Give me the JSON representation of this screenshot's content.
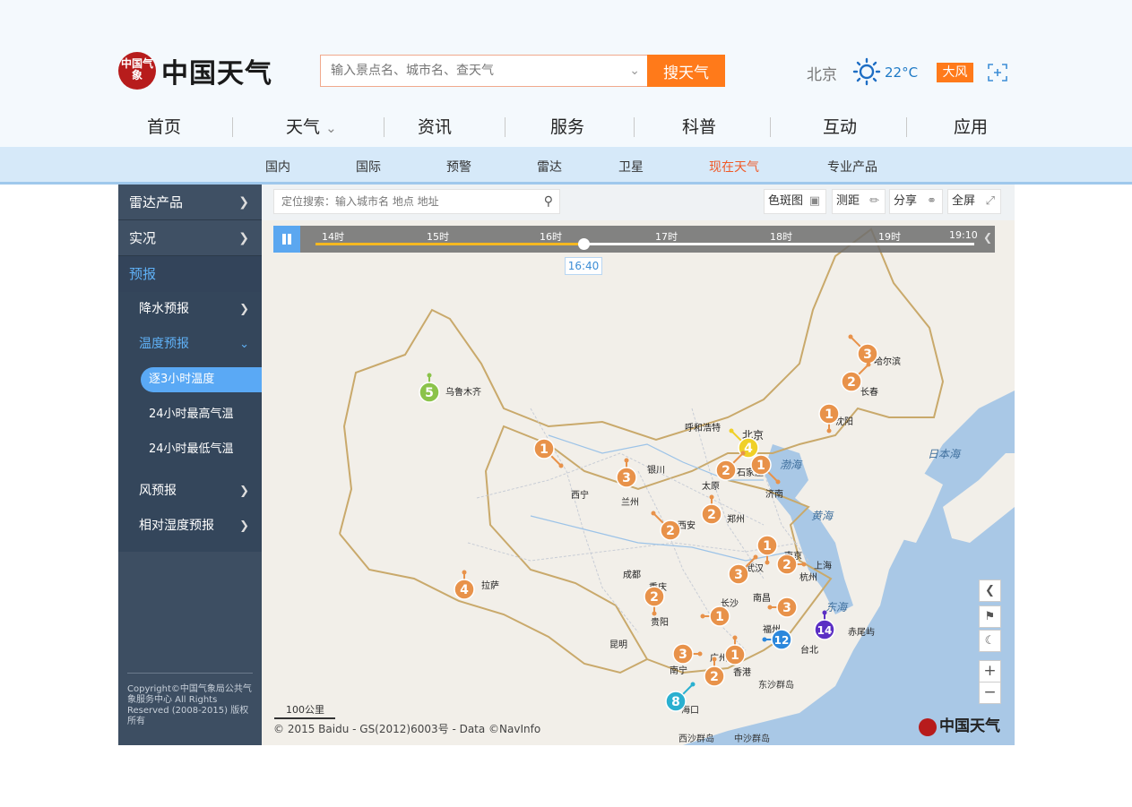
{
  "header": {
    "logo_seal_text": "中国气象",
    "logo_text": "中国天气",
    "search_placeholder": "输入景点名、城市名、查天气",
    "search_button": "搜天气",
    "city": "北京",
    "temperature": "22°C",
    "alert": "大风"
  },
  "main_nav": [
    "首页",
    "天气",
    "资讯",
    "服务",
    "科普",
    "互动",
    "应用"
  ],
  "sub_nav": {
    "items": [
      "国内",
      "国际",
      "预警",
      "雷达",
      "卫星",
      "现在天气",
      "专业产品"
    ],
    "active": "现在天气"
  },
  "sidebar": {
    "radar": "雷达产品",
    "live": "实况",
    "forecast": "预报",
    "precip": "降水预报",
    "temp": "温度预报",
    "temp_3h": "逐3小时温度",
    "temp_max": "24小时最高气温",
    "temp_min": "24小时最低气温",
    "wind": "风预报",
    "humidity": "相对湿度预报",
    "copyright": "Copyright©中国气象局公共气象服务中心 All Rights Reserved (2008-2015) 版权所有"
  },
  "map_toolbar": {
    "search_placeholder": "定位搜索：输入城市名 地点 地址",
    "color_map": "色斑图",
    "measure": "测距",
    "share": "分享",
    "fullscreen": "全屏"
  },
  "timeline": {
    "labels": [
      "14时",
      "15时",
      "16时",
      "17时",
      "18时",
      "19时",
      "19:10"
    ],
    "current": "16:40",
    "progress": 0.41
  },
  "map": {
    "cities": [
      "乌鲁木齐",
      "哈尔滨",
      "长春",
      "沈阳",
      "呼和浩特",
      "北京",
      "石家庄",
      "太原",
      "济南",
      "银川",
      "西宁",
      "兰州",
      "郑州",
      "西安",
      "南京",
      "上海",
      "杭州",
      "成都",
      "重庆",
      "武汉",
      "长沙",
      "南昌",
      "拉萨",
      "贵阳",
      "福州",
      "台北",
      "昆明",
      "南宁",
      "广州",
      "香港",
      "海口",
      "赤尾屿"
    ],
    "seas": [
      "渤海",
      "黄海",
      "东海",
      "日本海"
    ],
    "islands": [
      "东沙群岛",
      "西沙群岛",
      "中沙群岛"
    ],
    "markers": [
      "5",
      "3",
      "2",
      "1",
      "4",
      "1",
      "2",
      "1",
      "3",
      "2",
      "2",
      "1",
      "2",
      "3",
      "4",
      "2",
      "1",
      "3",
      "1",
      "3",
      "12",
      "14",
      "3",
      "1",
      "2",
      "8"
    ],
    "scale": "100公里",
    "copyright": "© 2015 Baidu - GS(2012)6003号 - Data ©NavInfo",
    "watermark": "中国天气"
  },
  "colors": {
    "accent": "#ff7a1a",
    "blue": "#5ba7f0",
    "sidebar": "#3d4e62",
    "active_nav": "#f05a28"
  }
}
